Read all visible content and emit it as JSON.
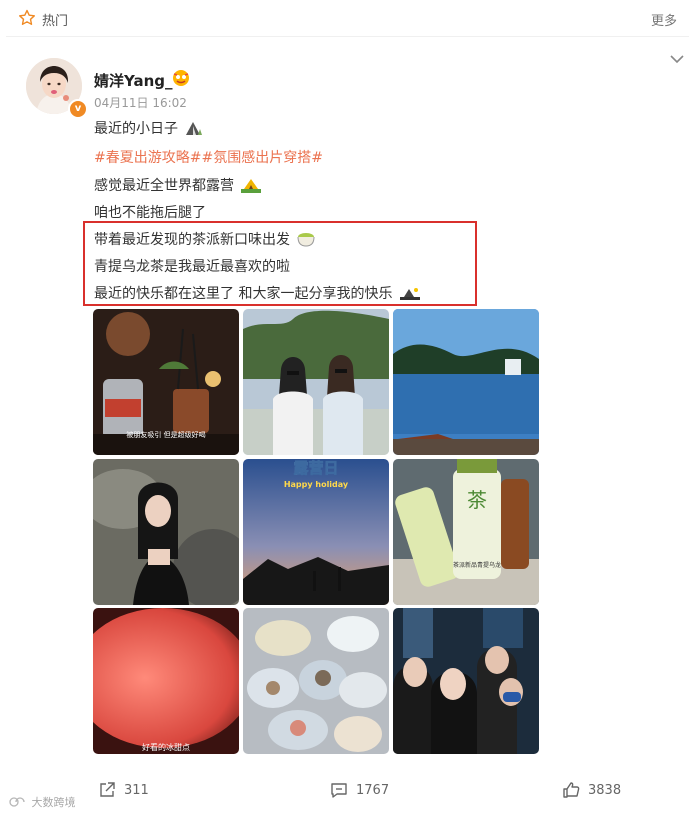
{
  "topbar": {
    "section": "热门",
    "more": "更多"
  },
  "post": {
    "username": "婧洋Yang_",
    "time": "04月11日 16:02",
    "lines": [
      "最近的小日子",
      "#春夏出游攻略##氛围感出片穿搭#",
      "感觉最近全世界都露营",
      "咱也不能拖后腿了",
      "带着最近发现的茶派新口味出发",
      "青提乌龙茶是我最近最喜欢的啦",
      "最近的快乐都在这里了 和大家一起分享我的快乐"
    ],
    "photo_texts": {
      "bar": "被朋友吸引 但是超级好喝",
      "camp_title": "露营日",
      "camp_subtitle": "Happy holiday",
      "tea_label": "茶",
      "tea_caption": "茶派新品青提乌龙",
      "dessert": "好看的冰甜点"
    },
    "actions": {
      "share": "311",
      "comment": "1767",
      "like": "3838"
    }
  },
  "colors": {
    "accent": "#eb7350",
    "highlight": "#d9302c",
    "verified": "#f08a24"
  },
  "watermark": "大数跨境"
}
